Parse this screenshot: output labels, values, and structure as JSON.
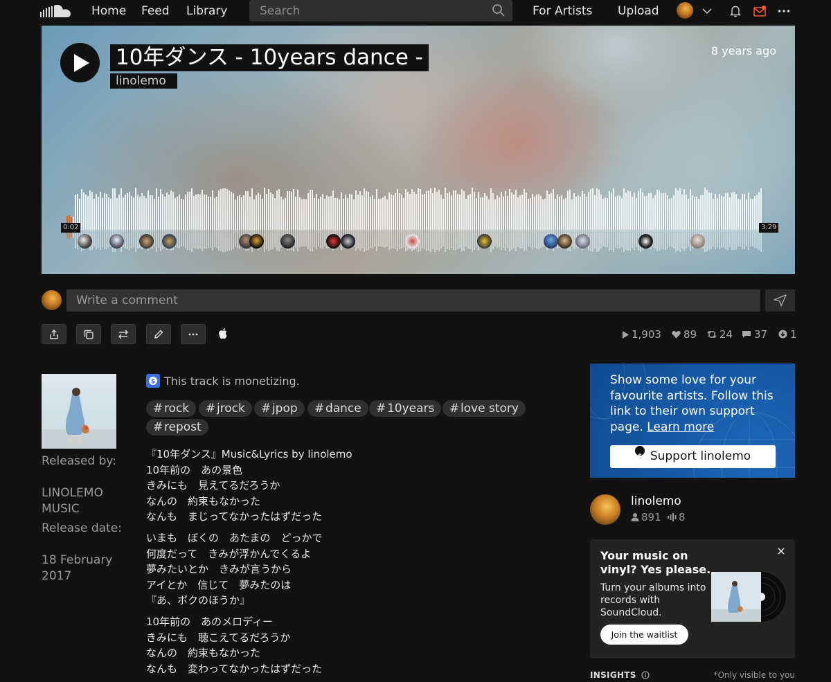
{
  "nav": {
    "logo_icon": "soundcloud-cloud-icon",
    "home": "Home",
    "feed": "Feed",
    "library": "Library",
    "search_placeholder": "Search",
    "for_artists": "For Artists",
    "upload": "Upload",
    "icons": [
      "chevron-down-icon",
      "bell-icon",
      "mail-icon",
      "more-icon"
    ],
    "mail_badge_color": "#f55a00"
  },
  "track": {
    "title": "10年ダンス - 10years dance -",
    "artist": "linolemo",
    "time_ago": "8 years ago",
    "elapsed": "0:02",
    "duration": "3:29",
    "progress_fraction": 0.01,
    "progress_color": "#f55a00"
  },
  "comment": {
    "placeholder": "Write a comment"
  },
  "actions": [
    "share-icon",
    "copy-link-icon",
    "repost-icon",
    "edit-icon",
    "more-icon",
    "apple-icon"
  ],
  "stats": {
    "plays": "1,903",
    "likes": "89",
    "reposts": "24",
    "comments": "37",
    "downloads": "1"
  },
  "meta": {
    "released_by_label": "Released by:",
    "released_by": "LINOLEMO MUSIC",
    "release_date_label": "Release date:",
    "release_date": "18 February 2017"
  },
  "monetizing": "This track is monetizing.",
  "tags": [
    "rock",
    "jrock",
    "jpop",
    "dance",
    "10years",
    "love story",
    "repost"
  ],
  "lyrics": [
    [
      "『10年ダンス』Music&Lyrics by linolemo",
      "10年前の　あの景色",
      "きみにも　見えてるだろうか",
      "なんの　約束もなかった",
      "なんも　まじってなかったはずだった"
    ],
    [
      "いまも　ぼくの　あたまの　どっかで",
      "何度だって　きみが浮かんでくるよ",
      "夢みたいとか　きみが言うから",
      "アイとか　信じて　夢みたのは",
      "『あ、ボクのほうか』"
    ],
    [
      "10年前の　あのメロディー",
      "きみにも　聴こえてるだろうか",
      "なんの　約束もなかった",
      "なんも　変わってなかったはずだった"
    ]
  ],
  "support": {
    "text": "Show some love for your favourite artists. Follow this link to their own support page.",
    "learn_more": "Learn more",
    "button": "Support linolemo",
    "color": "#1557a3"
  },
  "artist_card": {
    "name": "linolemo",
    "followers": "891",
    "tracks": "8"
  },
  "vinyl": {
    "title": "Your music on vinyl? Yes please.",
    "desc": "Turn your albums into records with SoundCloud.",
    "button": "Join the waitlist"
  },
  "insights": {
    "label": "INSIGHTS",
    "note": "*Only visible to you"
  }
}
